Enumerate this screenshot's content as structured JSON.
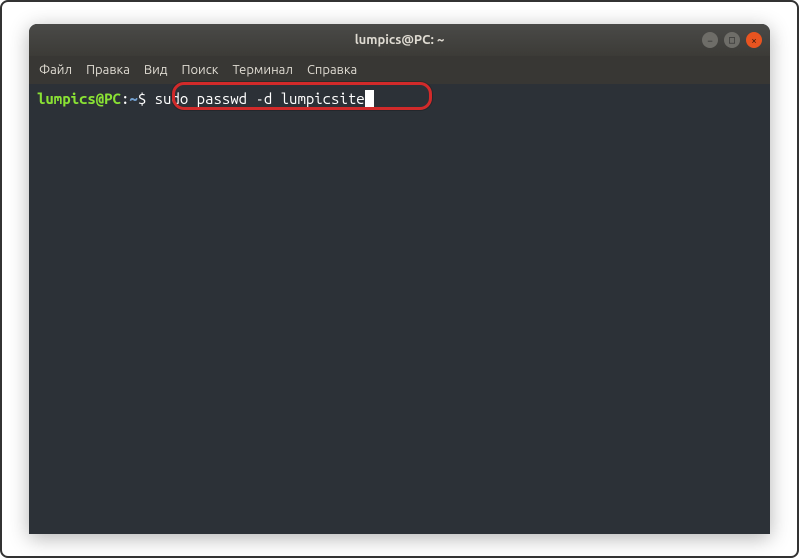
{
  "window": {
    "title": "lumpics@PC: ~"
  },
  "menu": {
    "file": "Файл",
    "edit": "Правка",
    "view": "Вид",
    "search": "Поиск",
    "terminal": "Терминал",
    "help": "Справка"
  },
  "prompt": {
    "user_host": "lumpics@PC",
    "colon": ":",
    "path": "~",
    "symbol": "$ "
  },
  "command": {
    "text": "sudo passwd -d lumpicsite"
  },
  "window_controls": {
    "minimize": "−",
    "maximize": "□",
    "close": "×"
  }
}
